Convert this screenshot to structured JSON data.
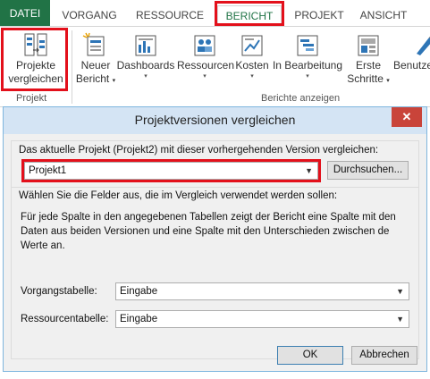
{
  "ribbon": {
    "tabs": [
      "DATEI",
      "VORGANG",
      "RESSOURCE",
      "BERICHT",
      "PROJEKT",
      "ANSICHT"
    ],
    "active_tab": "BERICHT",
    "buttons": {
      "compare_line1": "Projekte",
      "compare_line2": "vergleichen",
      "new_report_line1": "Neuer",
      "new_report_line2": "Bericht",
      "dashboards": "Dashboards",
      "resources": "Ressourcen",
      "costs": "Kosten",
      "in_progress": "In Bearbeitung",
      "first_steps_line1": "Erste",
      "first_steps_line2": "Schritte",
      "user": "Benutze"
    },
    "groups": {
      "project": "Projekt",
      "view_reports": "Berichte anzeigen"
    },
    "accent": "#217346",
    "highlight": "#e3101b"
  },
  "dialog": {
    "title": "Projektversionen vergleichen",
    "close_glyph": "✕",
    "compare_prompt": "Das aktuelle Projekt (Projekt2) mit dieser vorhergehenden Version vergleichen:",
    "project_value": "Projekt1",
    "browse_label": "Durchsuchen...",
    "fields_heading": "Wählen Sie die Felder aus, die im Vergleich verwendet werden sollen:",
    "description": "Für jede Spalte in den angegebenen Tabellen zeigt der Bericht eine Spalte mit den Daten aus beiden Versionen und eine Spalte mit den Unterschieden zwischen de Werte an.",
    "task_table_label": "Vorgangstabelle:",
    "task_table_value": "Eingabe",
    "resource_table_label": "Ressourcentabelle:",
    "resource_table_value": "Eingabe",
    "ok_label": "OK",
    "cancel_label": "Abbrechen"
  }
}
